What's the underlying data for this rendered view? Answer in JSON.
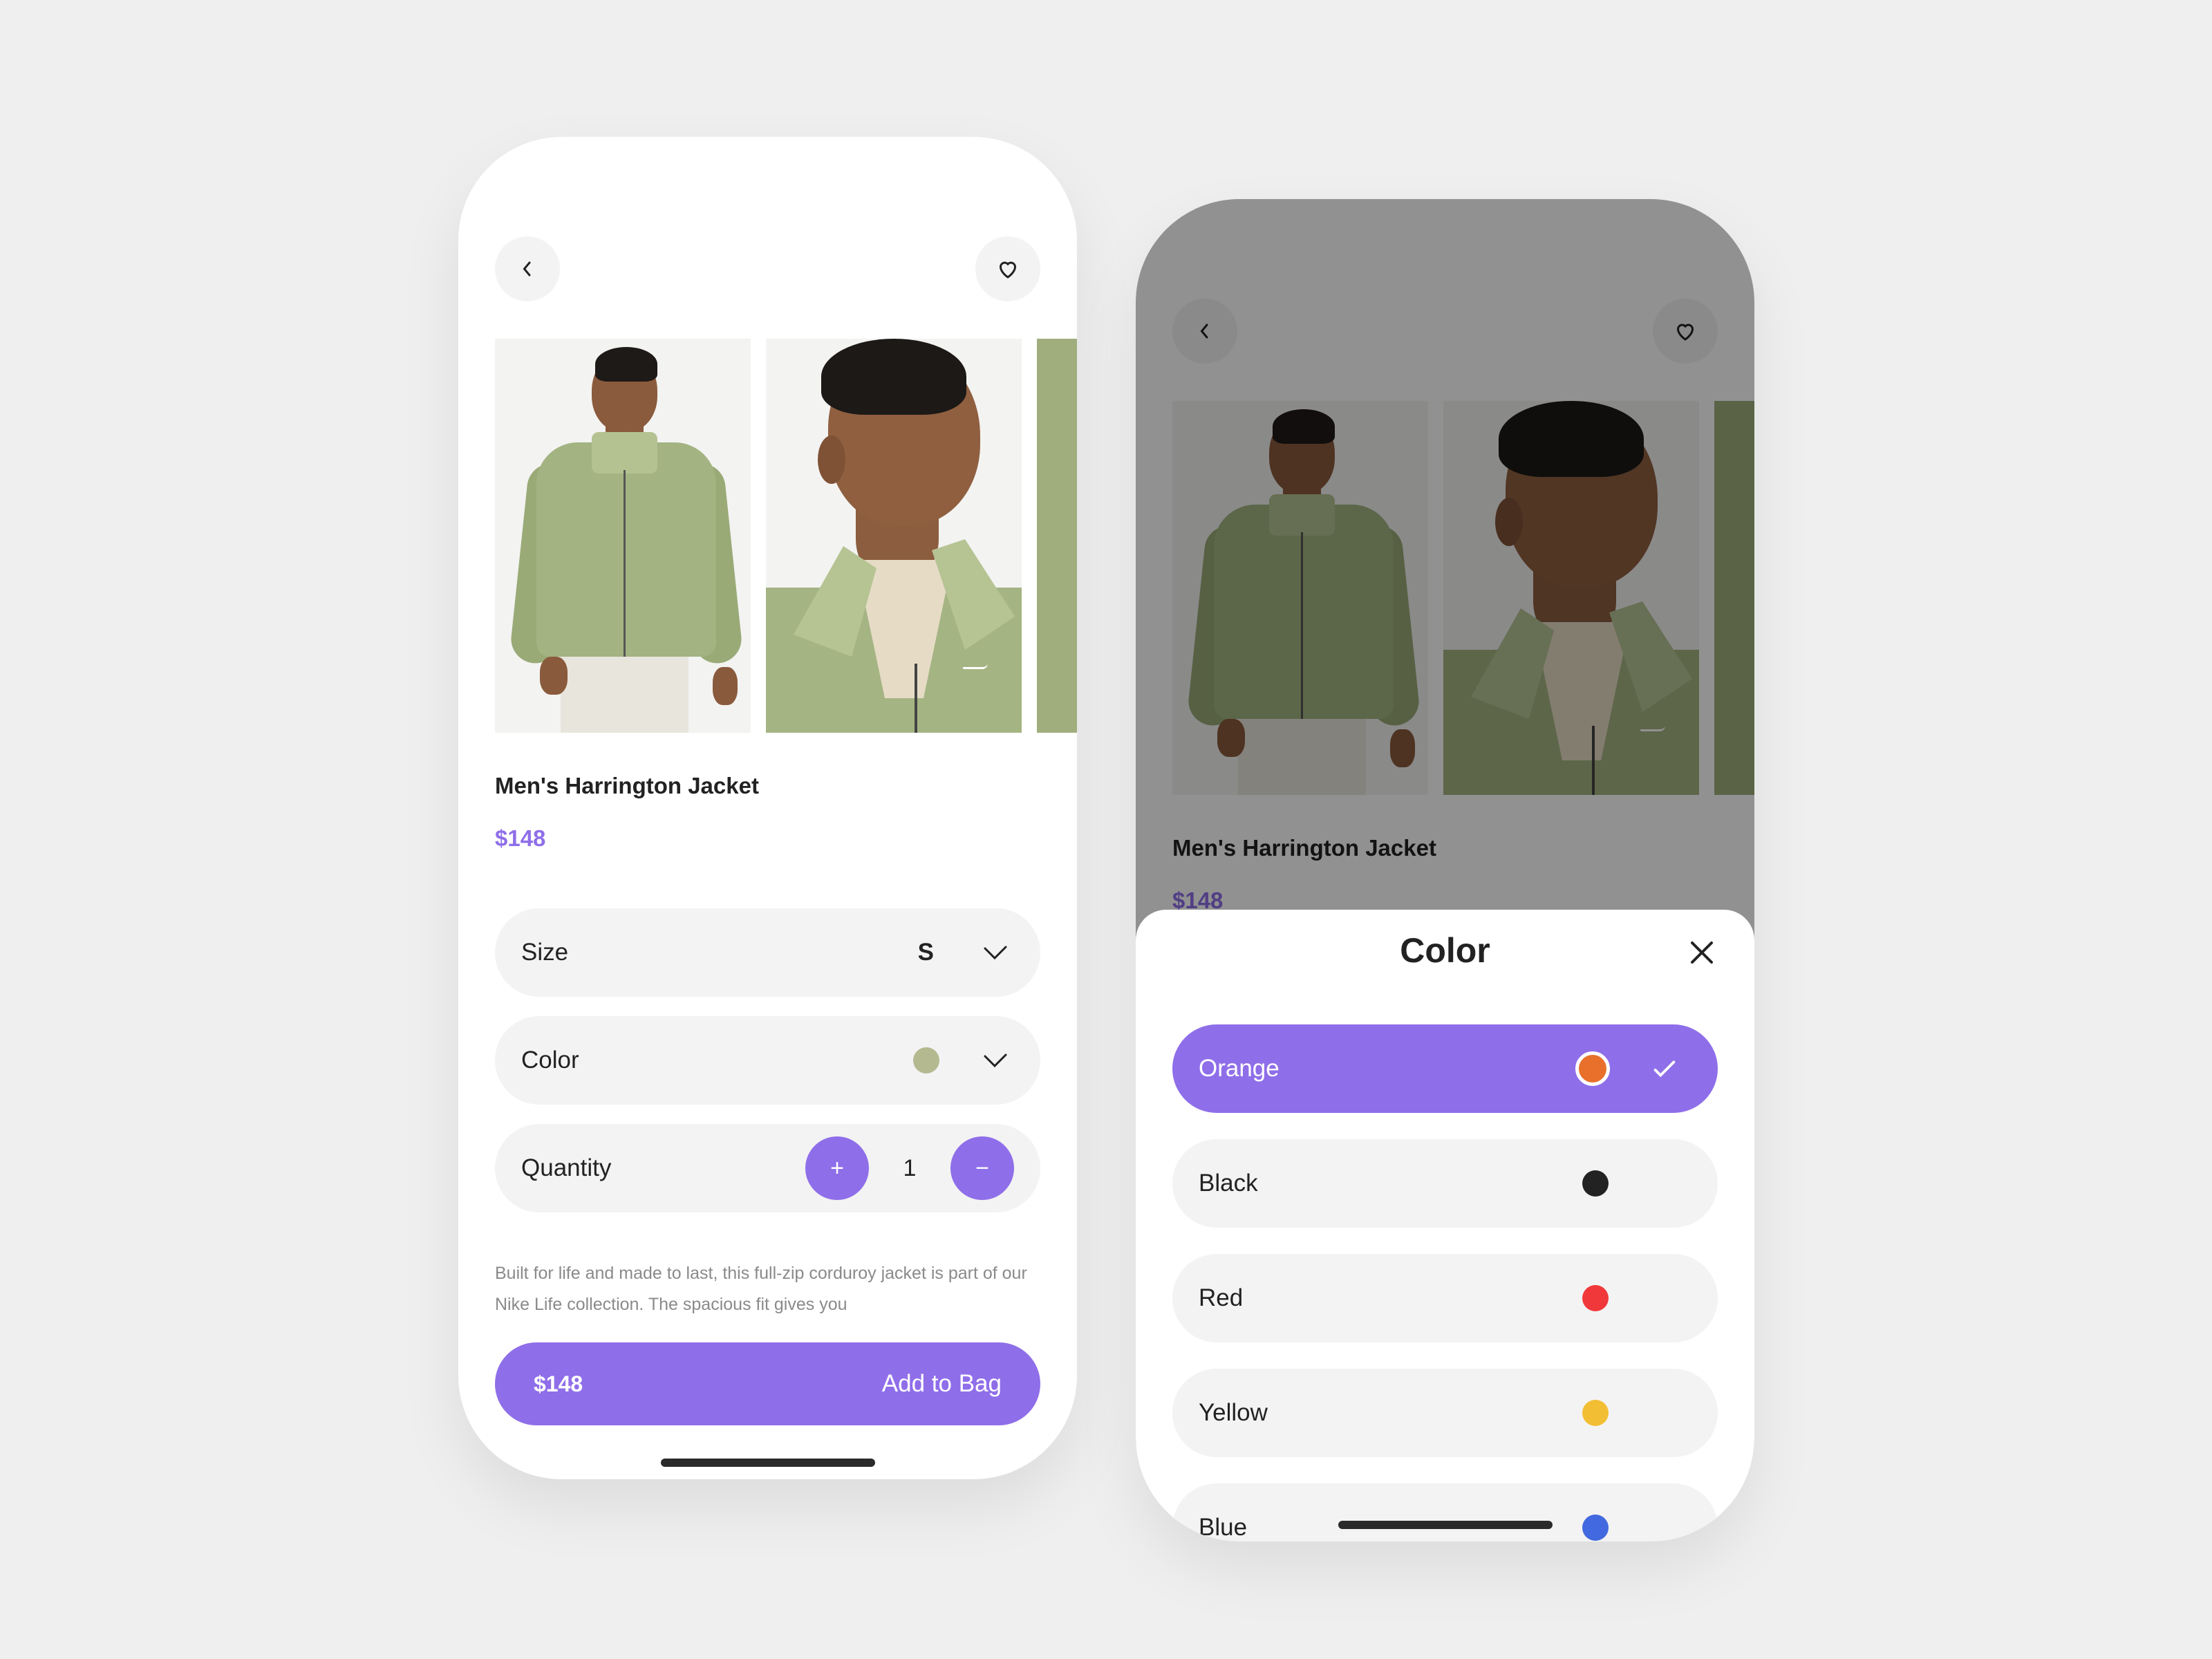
{
  "product": {
    "title": "Men's Harrington Jacket",
    "price": "$148",
    "description": "Built for life and made to last, this full-zip corduroy jacket is part of our Nike Life collection. The spacious fit gives you"
  },
  "header": {
    "back_icon": "chevron-left-icon",
    "favorite_icon": "heart-outline-icon"
  },
  "gallery": {
    "images": [
      "model-full-body-jacket",
      "model-closeup-collar",
      "fabric-detail"
    ]
  },
  "options": {
    "size": {
      "label": "Size",
      "value": "S"
    },
    "color": {
      "label": "Color",
      "swatch": "#b5b98f"
    },
    "quantity": {
      "label": "Quantity",
      "value": "1",
      "increment": "+",
      "decrement": "−"
    }
  },
  "cta": {
    "price": "$148",
    "label": "Add to Bag"
  },
  "color_sheet": {
    "title": "Color",
    "close_icon": "close-icon",
    "items": [
      {
        "label": "Orange",
        "color": "#e8702a",
        "selected": true
      },
      {
        "label": "Black",
        "color": "#222222",
        "selected": false
      },
      {
        "label": "Red",
        "color": "#f0383a",
        "selected": false
      },
      {
        "label": "Yellow",
        "color": "#f2be33",
        "selected": false
      },
      {
        "label": "Blue",
        "color": "#4369e0",
        "selected": false
      }
    ]
  },
  "colors": {
    "accent": "#8f6ee9",
    "row_bg": "#f3f3f3",
    "background": "#efefef"
  }
}
